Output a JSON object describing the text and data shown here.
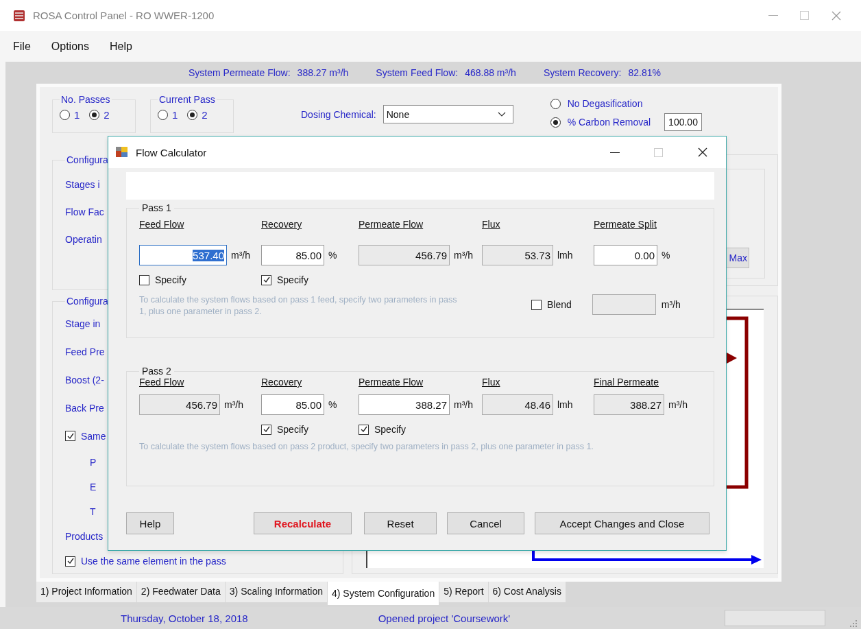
{
  "window": {
    "title": "ROSA Control Panel - RO WWER-1200"
  },
  "menu": [
    "File",
    "Options",
    "Help"
  ],
  "summary": [
    {
      "label": "System Permeate Flow:",
      "value": "388.27 m³/h"
    },
    {
      "label": "System Feed Flow:",
      "value": "468.88 m³/h"
    },
    {
      "label": "System Recovery:",
      "value": "82.81%"
    }
  ],
  "radio_groups": [
    {
      "title": "No. Passes",
      "options": [
        {
          "label": "1",
          "selected": false
        },
        {
          "label": "2",
          "selected": true
        }
      ]
    },
    {
      "title": "Current Pass",
      "options": [
        {
          "label": "1",
          "selected": false
        },
        {
          "label": "2",
          "selected": true
        }
      ]
    }
  ],
  "dosing": {
    "label": "Dosing Chemical:",
    "value": "None"
  },
  "degasification": [
    {
      "label": "No Degasification",
      "selected": false
    },
    {
      "label": "% Carbon Removal",
      "selected": true,
      "value": "100.00"
    }
  ],
  "left_groups": [
    {
      "title": "Configura",
      "rows": [
        {
          "kind": "label",
          "text": "Stages i"
        },
        {
          "kind": "label",
          "text": "Flow Fac"
        },
        {
          "kind": "label",
          "text": "Operatin"
        }
      ]
    },
    {
      "title": "Configura",
      "rows": [
        {
          "kind": "label",
          "text": "Stage in"
        },
        {
          "kind": "label",
          "text": "Feed Pre"
        },
        {
          "kind": "label",
          "text": "Boost (2-"
        },
        {
          "kind": "label",
          "text": "Back Pre"
        },
        {
          "kind": "checkbox",
          "text": "Same",
          "checked": true
        },
        {
          "kind": "sublabel",
          "text": "P"
        },
        {
          "kind": "sublabel",
          "text": "E"
        },
        {
          "kind": "sublabel",
          "text": "T"
        },
        {
          "kind": "label",
          "text": "Products"
        },
        {
          "kind": "checkbox",
          "text": "Use the same element in the pass",
          "checked": true
        }
      ]
    }
  ],
  "max_button": "Max",
  "tabs": [
    {
      "label": "1) Project Information",
      "selected": false
    },
    {
      "label": "2) Feedwater Data",
      "selected": false
    },
    {
      "label": "3) Scaling Information",
      "selected": false
    },
    {
      "label": "4) System Configuration",
      "selected": true
    },
    {
      "label": "5) Report",
      "selected": false
    },
    {
      "label": "6) Cost Analysis",
      "selected": false
    }
  ],
  "status_bar": {
    "date": "Thursday, October 18, 2018",
    "message": "Opened project 'Coursework'"
  },
  "dialog": {
    "title": "Flow Calculator",
    "passes": [
      {
        "title": "Pass 1",
        "columns": [
          {
            "heading": "Feed Flow",
            "value": "537.40",
            "unit": "m³/h",
            "editable": true,
            "focused": true,
            "specify": {
              "label": "Specify",
              "checked": false
            }
          },
          {
            "heading": "Recovery",
            "value": "85.00",
            "unit": "%",
            "editable": true,
            "focused": false,
            "specify": {
              "label": "Specify",
              "checked": true
            }
          },
          {
            "heading": "Permeate Flow",
            "value": "456.79",
            "unit": "m³/h",
            "editable": false,
            "focused": false
          },
          {
            "heading": "Flux",
            "value": "53.73",
            "unit": "lmh",
            "editable": false,
            "focused": false
          },
          {
            "heading": "Permeate Split",
            "value": "0.00",
            "unit": "%",
            "editable": true,
            "focused": false
          }
        ],
        "note": "To calculate the system flows based on pass 1 feed, specify two parameters in pass 1, plus one parameter in pass 2.",
        "blend": {
          "label": "Blend",
          "checked": false,
          "unit": "m³/h"
        }
      },
      {
        "title": "Pass 2",
        "columns": [
          {
            "heading": "Feed Flow",
            "value": "456.79",
            "unit": "m³/h",
            "editable": false,
            "focused": false
          },
          {
            "heading": "Recovery",
            "value": "85.00",
            "unit": "%",
            "editable": true,
            "focused": false,
            "specify": {
              "label": "Specify",
              "checked": true
            }
          },
          {
            "heading": "Permeate Flow",
            "value": "388.27",
            "unit": "m³/h",
            "editable": true,
            "focused": false,
            "specify": {
              "label": "Specify",
              "checked": true
            }
          },
          {
            "heading": "Flux",
            "value": "48.46",
            "unit": "lmh",
            "editable": false,
            "focused": false
          },
          {
            "heading": "Final Permeate",
            "value": "388.27",
            "unit": "m³/h",
            "editable": false,
            "focused": false
          }
        ],
        "note": "To calculate the system flows based on pass 2 product, specify two parameters in pass 2, plus one parameter in pass 1."
      }
    ],
    "buttons": [
      {
        "label": "Help",
        "kind": "normal"
      },
      {
        "label": "Recalculate",
        "kind": "primary"
      },
      {
        "label": "Reset",
        "kind": "normal"
      },
      {
        "label": "Cancel",
        "kind": "normal"
      },
      {
        "label": "Accept Changes and Close",
        "kind": "normal"
      }
    ]
  }
}
